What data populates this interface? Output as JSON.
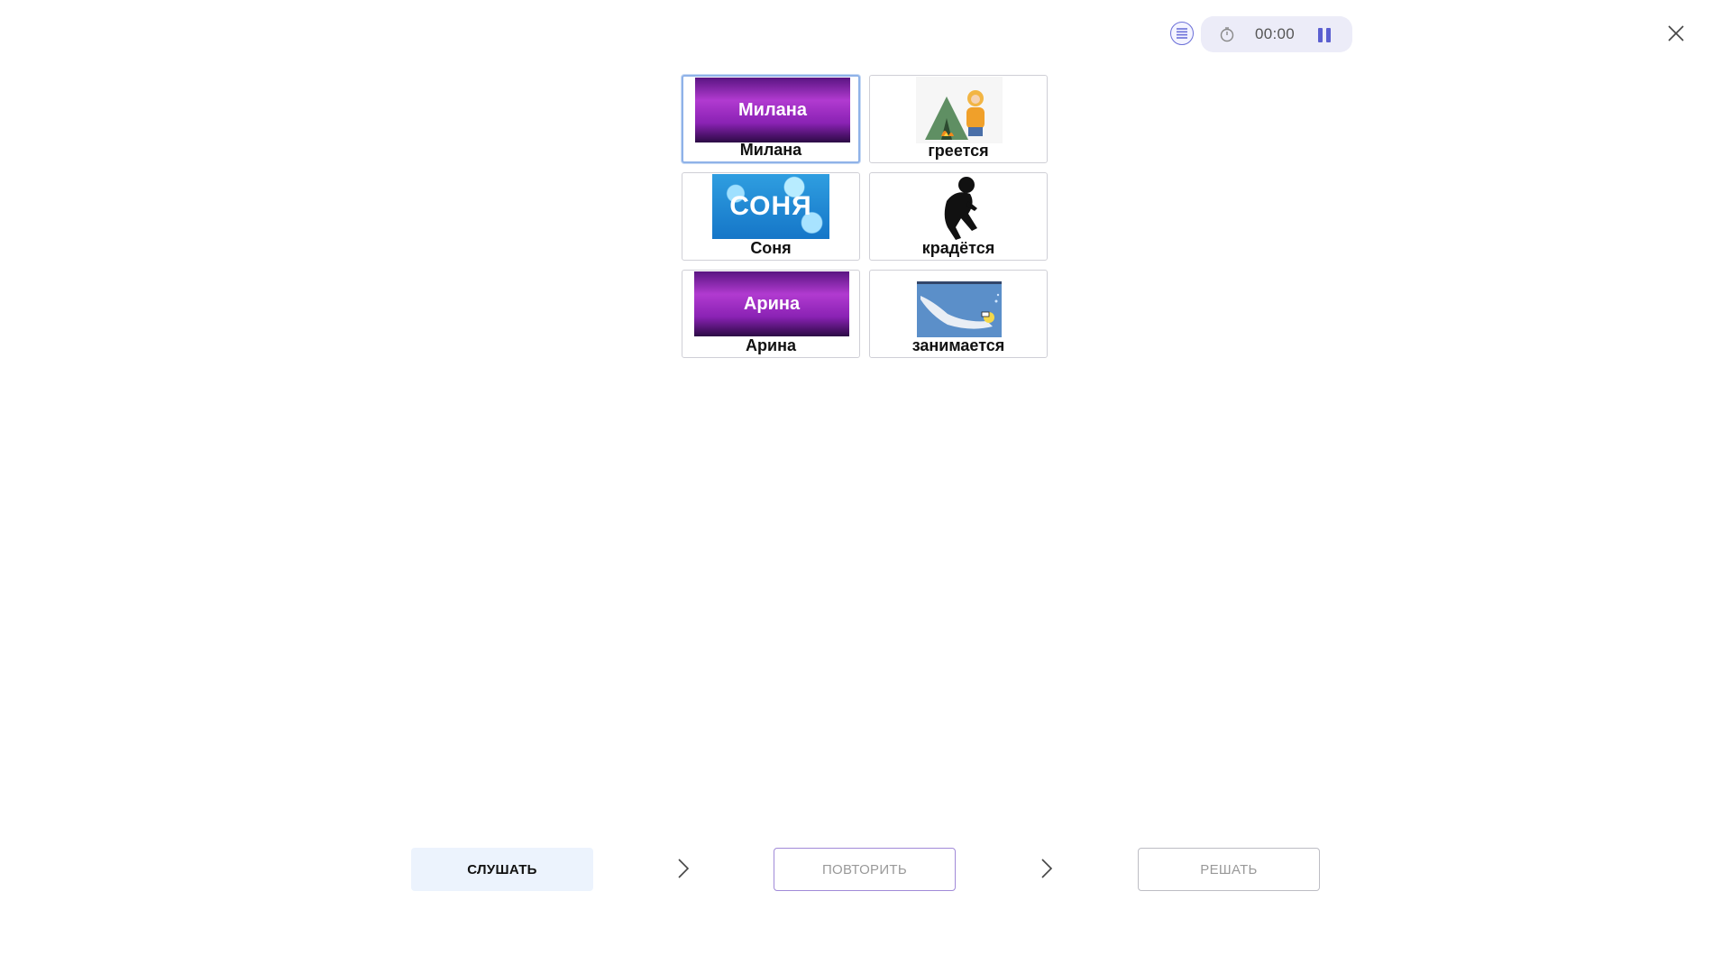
{
  "timer": {
    "time": "00:00"
  },
  "cards": [
    {
      "label": "Милана",
      "banner_text": "Милана",
      "selected": true
    },
    {
      "label": "греется",
      "picture": "person-warming-by-campfire"
    },
    {
      "label": "Соня",
      "banner_text": "СОНЯ"
    },
    {
      "label": "крадётся",
      "picture": "sneaking-silhouette"
    },
    {
      "label": "Арина",
      "banner_text": "Арина"
    },
    {
      "label": "занимается",
      "picture": "scuba-diver"
    }
  ],
  "buttons": {
    "listen": "СЛУШАТЬ",
    "repeat": "ПОВТОРИТЬ",
    "solve": "РЕШАТЬ"
  },
  "colors": {
    "accent": "#6b6fd8",
    "selected_border": "#8fb2e8",
    "listen_bg": "#ecf3fd"
  }
}
